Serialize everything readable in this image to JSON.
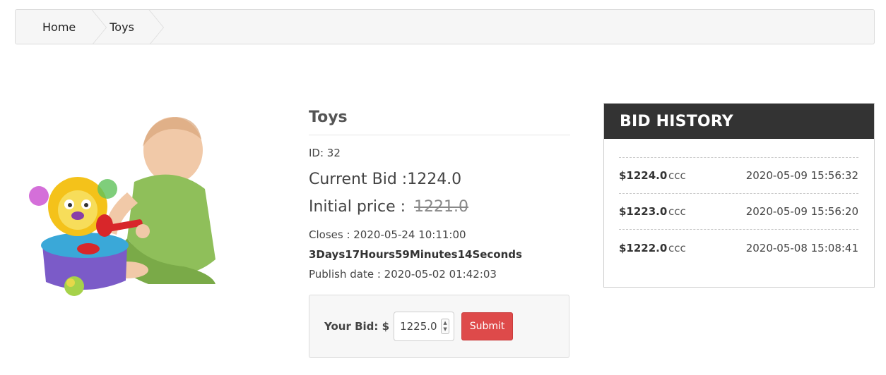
{
  "breadcrumb": {
    "items": [
      {
        "label": "Home"
      },
      {
        "label": "Toys"
      }
    ]
  },
  "product": {
    "title": "Toys",
    "id_text": "ID: 32",
    "current_bid_text": "Current Bid :1224.0",
    "initial_label": "Initial price :",
    "initial_value": "1221.0",
    "closes_text": "Closes : 2020-05-24 10:11:00",
    "countdown": "3Days17Hours59Minutes14Seconds",
    "publish_text": "Publish date : 2020-05-02 01:42:03",
    "image_icon": "baby-toy-photo"
  },
  "bid_form": {
    "label": "Your Bid: $",
    "value": "1225.0",
    "submit_label": "Submit"
  },
  "history": {
    "title": "BID HISTORY",
    "rows": [
      {
        "amount": "$1224.0",
        "user": "ccc",
        "time": "2020-05-09 15:56:32"
      },
      {
        "amount": "$1223.0",
        "user": "ccc",
        "time": "2020-05-09 15:56:20"
      },
      {
        "amount": "$1222.0",
        "user": "ccc",
        "time": "2020-05-08 15:08:41"
      }
    ]
  },
  "colors": {
    "accent": "#de4a4a",
    "history_header": "#333333",
    "panel_bg": "#f7f7f7"
  }
}
